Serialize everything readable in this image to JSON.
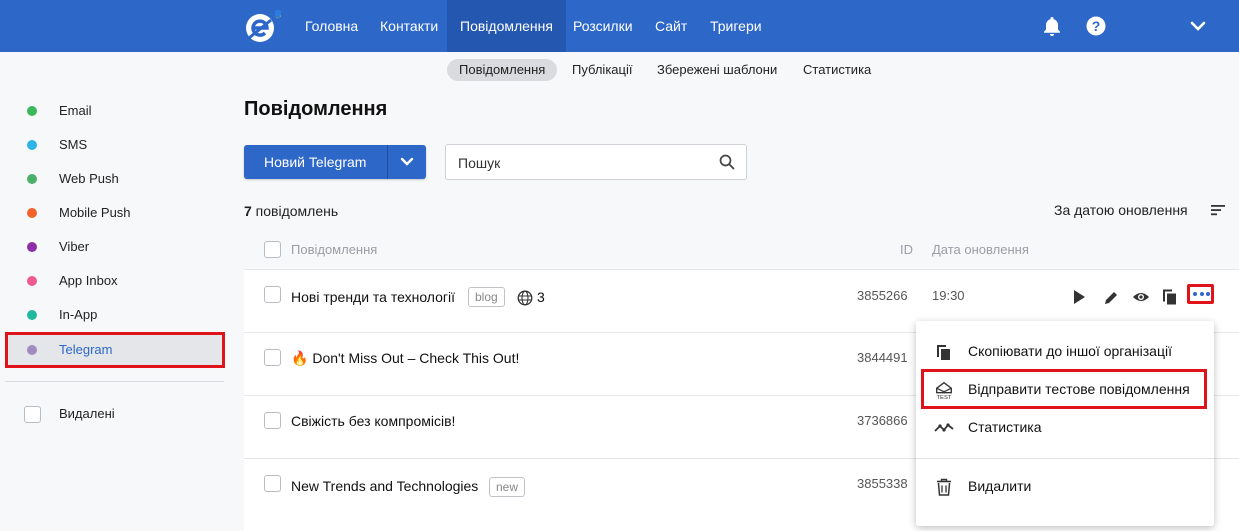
{
  "nav": {
    "items": [
      {
        "label": "Головна"
      },
      {
        "label": "Контакти"
      },
      {
        "label": "Повідомлення",
        "active": true
      },
      {
        "label": "Розсилки"
      },
      {
        "label": "Сайт"
      },
      {
        "label": "Тригери"
      }
    ],
    "icons": [
      "bell-icon",
      "help-icon",
      "chevron-down-icon"
    ]
  },
  "subnav": {
    "tabs": [
      {
        "label": "Повідомлення",
        "active": true
      },
      {
        "label": "Публікації"
      },
      {
        "label": "Збережені шаблони"
      },
      {
        "label": "Статистика"
      }
    ]
  },
  "sidebar": {
    "channels": [
      {
        "label": "Email",
        "color": "#3cb85c"
      },
      {
        "label": "SMS",
        "color": "#2bb5e8"
      },
      {
        "label": "Web Push",
        "color": "#4caf6a"
      },
      {
        "label": "Mobile Push",
        "color": "#f0622a"
      },
      {
        "label": "Viber",
        "color": "#8e2fa8"
      },
      {
        "label": "App Inbox",
        "color": "#ef5b8e"
      },
      {
        "label": "In-App",
        "color": "#21b8a0"
      },
      {
        "label": "Telegram",
        "color": "#a18bc0",
        "selected": true
      }
    ],
    "deleted_label": "Видалені"
  },
  "main": {
    "title": "Повідомлення",
    "new_button_label": "Новий Telegram",
    "search_placeholder": "Пошук",
    "count_number": "7",
    "count_suffix": " повідомлень",
    "sort_label": "За датою оновлення",
    "columns": {
      "message": "Повідомлення",
      "id": "ID",
      "date": "Дата оновлення"
    }
  },
  "rows": [
    {
      "title": "Нові тренди та технології",
      "tag": "blog",
      "langs": "3",
      "id": "3855266",
      "date": "19:30"
    },
    {
      "emoji": "🔥",
      "title": "Don't Miss Out – Check This Out!",
      "id": "3844491"
    },
    {
      "title": "Свіжість без компромісів!",
      "id": "3736866"
    },
    {
      "title": "New Trends and Technologies",
      "tag": "new",
      "id": "3855338"
    }
  ],
  "menu": {
    "items": [
      {
        "label": "Скопіювати до іншої організації",
        "icon": "copy-icon"
      },
      {
        "label": "Відправити тестове повідомлення",
        "icon": "test-message-icon",
        "highlighted": true
      },
      {
        "label": "Статистика",
        "icon": "statistics-icon"
      },
      {
        "label": "Видалити",
        "icon": "trash-icon"
      }
    ]
  },
  "colors": {
    "brand": "#2d67c8",
    "highlight": "#e0121a"
  }
}
